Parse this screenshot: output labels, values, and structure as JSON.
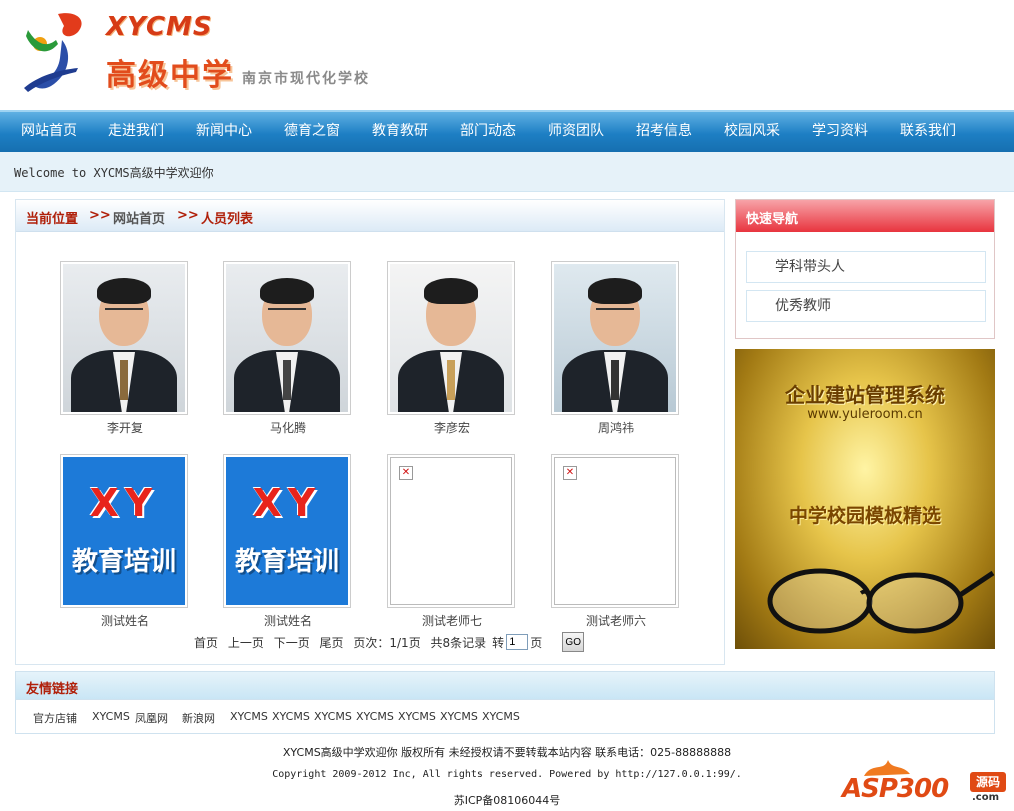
{
  "header": {
    "logo_en": "XYCMS",
    "logo_cn": "高级中学",
    "logo_sub": "南京市现代化学校"
  },
  "nav": {
    "items": [
      "网站首页",
      "走进我们",
      "新闻中心",
      "德育之窗",
      "教育教研",
      "部门动态",
      "师资团队",
      "招考信息",
      "校园风采",
      "学习资料",
      "联系我们"
    ]
  },
  "welcome": "Welcome to XYCMS高级中学欢迎你",
  "breadcrumb": {
    "label": "当前位置",
    "sep": ">>",
    "home": "网站首页",
    "current": "人员列表"
  },
  "people": [
    {
      "name": "李开复",
      "photo": "portrait"
    },
    {
      "name": "马化腾",
      "photo": "portrait"
    },
    {
      "name": "李彦宏",
      "photo": "portrait"
    },
    {
      "name": "周鸿祎",
      "photo": "portrait"
    },
    {
      "name": "测试姓名",
      "photo": "xy-banner"
    },
    {
      "name": "测试姓名",
      "photo": "xy-banner"
    },
    {
      "name": "测试老师七",
      "photo": "broken-image"
    },
    {
      "name": "测试老师六",
      "photo": "broken-image"
    }
  ],
  "xy_banner": {
    "top": "XY",
    "bottom": "教育培训"
  },
  "pager": {
    "first": "首页",
    "prev": "上一页",
    "next": "下一页",
    "last": "尾页",
    "page_info": "页次：1/1页",
    "records": "共8条记录",
    "goto": "转",
    "page_value": "1",
    "page_unit": "页",
    "go": "GO"
  },
  "sidebar": {
    "title": "快速导航",
    "links": [
      "学科带头人",
      "优秀教师"
    ]
  },
  "ad": {
    "title": "企业建站管理系统",
    "url": "www.yuleroom.cn",
    "subtitle": "中学校园模板精选"
  },
  "friend_links": {
    "title": "友情链接",
    "items": [
      "官方店铺",
      "XYCMS",
      "凤凰网",
      "新浪网",
      "XYCMS",
      "XYCMS",
      "XYCMS",
      "XYCMS",
      "XYCMS",
      "XYCMS",
      "XYCMS"
    ]
  },
  "footer": {
    "line1": "XYCMS高级中学欢迎你 版权所有 未经授权请不要转载本站内容 联系电话：025-88888888",
    "line2": "Copyright 2009-2012 Inc, All rights reserved. Powered by http://127.0.0.1:99/.",
    "line3": "苏ICP备08106044号"
  },
  "watermark": {
    "brand": "ASP300",
    "badge": "源码",
    "domain": ".com"
  },
  "colors": {
    "nav_blue": "#1d7fc4",
    "accent_red": "#b0200a",
    "side_head_red": "#e8343e",
    "logo_orange": "#e24c1c"
  }
}
